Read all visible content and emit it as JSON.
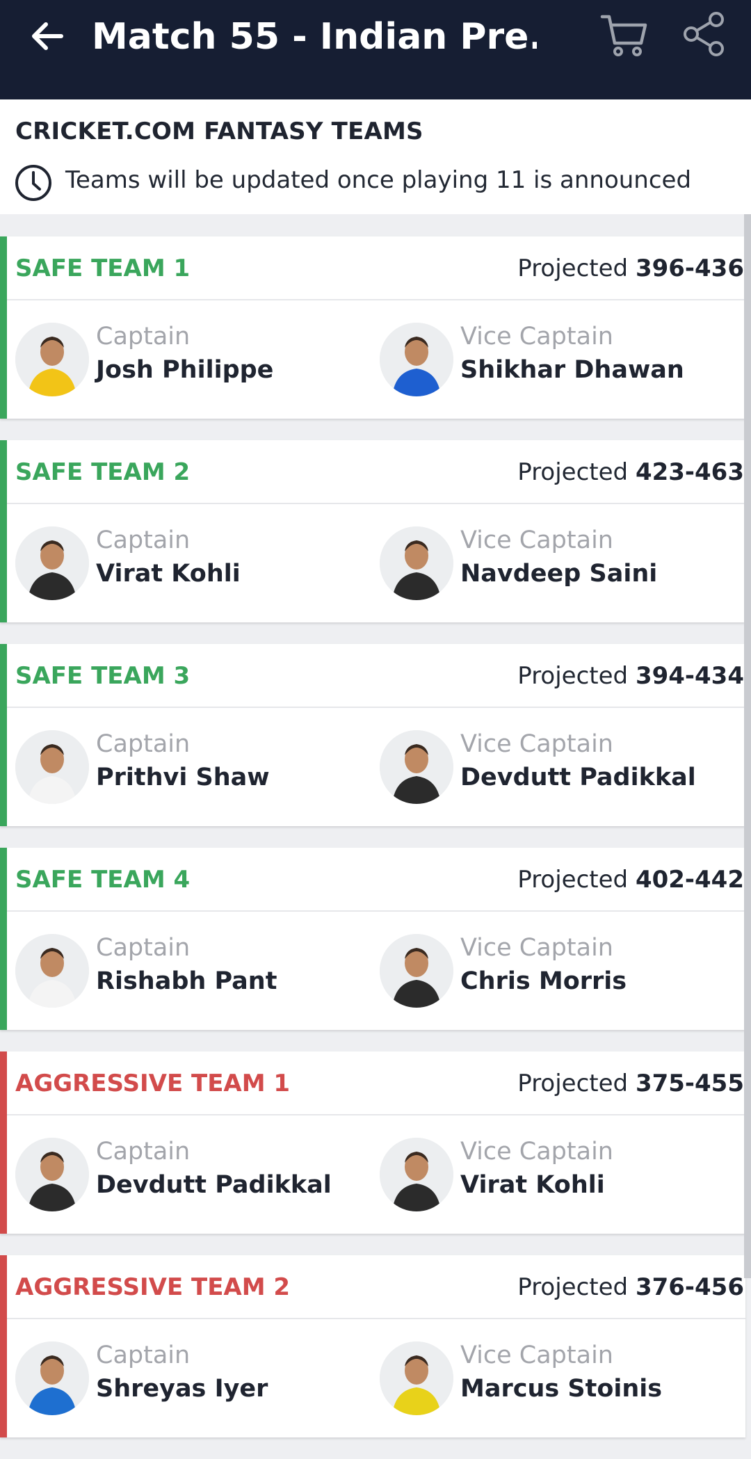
{
  "appbar": {
    "title": "Match 55 - Indian Pre...",
    "icons": [
      "back-arrow-icon",
      "cart-icon",
      "share-icon"
    ]
  },
  "section": {
    "heading": "CRICKET.COM FANTASY TEAMS",
    "note": "Teams will be updated once playing 11 is announced",
    "note_icon": "clock-icon"
  },
  "colors": {
    "appbar_bg": "#161e33",
    "safe": "#3aa65c",
    "aggressive": "#d24b4b"
  },
  "labels": {
    "projected": "Projected",
    "captain": "Captain",
    "vice_captain": "Vice Captain"
  },
  "teams": [
    {
      "name": "SAFE TEAM 1",
      "type": "safe",
      "projected": "396-436",
      "captain": "Josh Philippe",
      "vice_captain": "Shikhar Dhawan",
      "captain_kit": "#f2c417",
      "vc_kit": "#1e5fd0"
    },
    {
      "name": "SAFE TEAM 2",
      "type": "safe",
      "projected": "423-463",
      "captain": "Virat Kohli",
      "vice_captain": "Navdeep Saini",
      "captain_kit": "#2b2b2b",
      "vc_kit": "#2b2b2b"
    },
    {
      "name": "SAFE TEAM 3",
      "type": "safe",
      "projected": "394-434",
      "captain": "Prithvi Shaw",
      "vice_captain": "Devdutt Padikkal",
      "captain_kit": "#f4f4f4",
      "vc_kit": "#2b2b2b"
    },
    {
      "name": "SAFE TEAM 4",
      "type": "safe",
      "projected": "402-442",
      "captain": "Rishabh Pant",
      "vice_captain": "Chris Morris",
      "captain_kit": "#f4f4f4",
      "vc_kit": "#2b2b2b"
    },
    {
      "name": "AGGRESSIVE TEAM 1",
      "type": "aggressive",
      "projected": "375-455",
      "captain": "Devdutt Padikkal",
      "vice_captain": "Virat Kohli",
      "captain_kit": "#2b2b2b",
      "vc_kit": "#2b2b2b"
    },
    {
      "name": "AGGRESSIVE TEAM 2",
      "type": "aggressive",
      "projected": "376-456",
      "captain": "Shreyas Iyer",
      "vice_captain": "Marcus Stoinis",
      "captain_kit": "#1e6fd0",
      "vc_kit": "#e8d21a"
    }
  ]
}
